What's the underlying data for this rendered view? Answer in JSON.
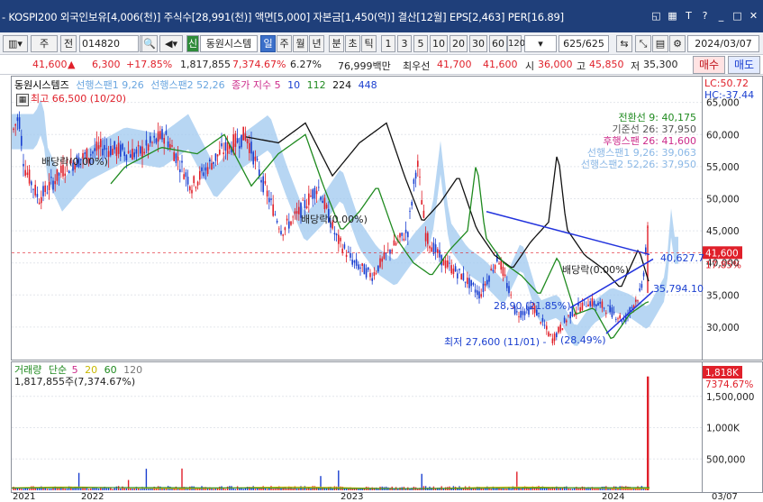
{
  "titlebar": {
    "text": "- KOSPI200 외국인보유[4,006(천)] 주식수[28,991(천)] 액면[5,000] 자본금[1,450(억)] 결산[12월] EPS[2,463] PER[16.89]"
  },
  "toolbar": {
    "stock_code": "014820",
    "stock_name": "동원시스템",
    "market_type": "주",
    "prev_label": "전",
    "period_day": "일",
    "period_week": "주",
    "period_month": "월",
    "period_year": "년",
    "period_min": "분",
    "period_sec": "초",
    "period_tick": "틱",
    "interval_1": "1",
    "interval_3": "3",
    "interval_5": "5",
    "interval_10": "10",
    "interval_20": "20",
    "interval_30": "30",
    "interval_60": "60",
    "interval_120": "120",
    "count": "625/625",
    "date": "2024/03/07",
    "sin_label": "신"
  },
  "price": {
    "current": "41,600",
    "change_arrow": "▲",
    "change": "6,300",
    "change_pct": "+17.85%",
    "volume": "1,817,855",
    "volume_ratio": "7,374.67%",
    "turnover": "6.27%",
    "amount": "76,999백만",
    "best_bid_label": "최우선",
    "best_ask": "41,700",
    "best_bid": "41,600",
    "open_label": "시",
    "open": "36,000",
    "high_label": "고",
    "high": "45,850",
    "low_label": "저",
    "low": "35,300",
    "buy_label": "매수",
    "sell_label": "매도"
  },
  "chart": {
    "legend_name": "동원시스템즈",
    "legend_span1": "선행스팬1 9,26",
    "legend_span2": "선행스팬2 52,26",
    "legend_close": "종가 지수",
    "ma": [
      "5",
      "10",
      "112",
      "224",
      "448"
    ],
    "lc_label": "LC:50.72",
    "hc_label": "HC:-37.44",
    "high_note": "최고 66,500 (10/20)",
    "low_note": "최저 27,600 (11/01) -",
    "low_pct": "(28.49%)",
    "div1": "배당락(0.00%)",
    "div2": "배당락(0.00%)",
    "div3": "배당락(0.00%)",
    "pt1": "28,90 (21.85%)",
    "pt2": "35,794.10",
    "pt3": "40,627.7",
    "current_tag": "41,600",
    "current_pct": "17.85%",
    "ichimoku": {
      "conversion": "전환선 9: 40,175",
      "base": "기준선 26: 37,950",
      "lagging": "후행스팬 26: 41,600",
      "span1": "선행스팬1 9,26: 39,063",
      "span2": "선행스팬2 52,26: 37,950"
    },
    "price_ticks": [
      "65,000",
      "60,000",
      "55,000",
      "50,000",
      "45,000",
      "40,000",
      "35,000",
      "30,000"
    ],
    "date_labels": [
      "2021",
      "2022",
      "2023",
      "2024",
      "03/07"
    ]
  },
  "volume_panel": {
    "legend_title": "거래량",
    "legend_type": "단순",
    "ma": [
      "5",
      "20",
      "60",
      "120"
    ],
    "value_line": "1,817,855주(7,374.67%)",
    "current_tag": "1,818K",
    "current_pct": "7374.67%",
    "ticks": [
      "1,500,000",
      "1,000K",
      "500,000"
    ]
  },
  "colors": {
    "up": "#e0202a",
    "down": "#1a3fd0",
    "cloud": "#9fc8ef",
    "ma_black": "#111111",
    "ma_green": "#1f8a1f",
    "trend_blue": "#2233dd"
  }
}
